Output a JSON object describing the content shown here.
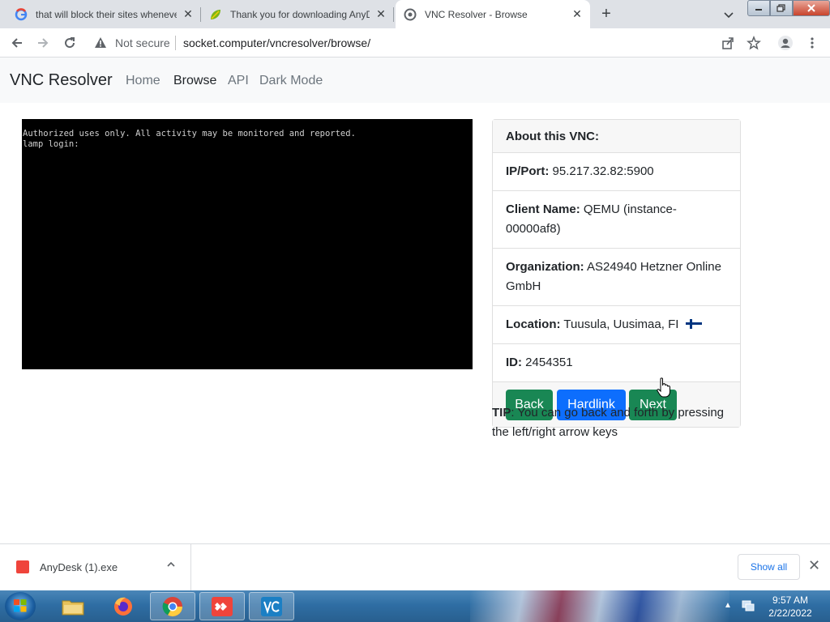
{
  "browser": {
    "tabs": [
      {
        "title": "that will block their sites whenever",
        "favicon": "google-icon",
        "active": false
      },
      {
        "title": "Thank you for downloading AnyDesk",
        "favicon": "anydesk-leaf-icon",
        "active": false
      },
      {
        "title": "VNC Resolver - Browse",
        "favicon": "vnc-resolver-icon",
        "active": true
      }
    ],
    "address": {
      "security_label": "Not secure",
      "url": "socket.computer/vncresolver/browse/"
    }
  },
  "page": {
    "brand": "VNC Resolver",
    "nav": [
      "Home",
      "Browse",
      "API",
      "Dark Mode"
    ],
    "active_nav": "Browse",
    "vnc_screen": {
      "line1": "Authorized uses only. All activity may be monitored and reported.",
      "line2": "lamp login:"
    },
    "about": {
      "header": "About this VNC:",
      "ip_label": "IP/Port:",
      "ip_value": "95.217.32.82:5900",
      "client_label": "Client Name:",
      "client_value": "QEMU (instance-00000af8)",
      "org_label": "Organization:",
      "org_value": "AS24940 Hetzner Online GmbH",
      "location_label": "Location:",
      "location_value": "Tuusula, Uusimaa, FI",
      "location_flag": "finland-flag-icon",
      "id_label": "ID:",
      "id_value": "2454351"
    },
    "buttons": {
      "back": "Back",
      "hardlink": "Hardlink",
      "next": "Next"
    },
    "tip": {
      "label": "TIP",
      "text": ": You can go back and forth by pressing the left/right arrow keys"
    },
    "colors": {
      "green": "#198754",
      "blue": "#0d6efd"
    }
  },
  "downloads": {
    "file_name": "AnyDesk (1).exe",
    "show_all": "Show all"
  },
  "taskbar": {
    "time": "9:57 AM",
    "date": "2/22/2022",
    "apps": [
      "file-explorer-icon",
      "firefox-icon",
      "chrome-icon",
      "anydesk-icon",
      "vnc-viewer-icon"
    ]
  }
}
